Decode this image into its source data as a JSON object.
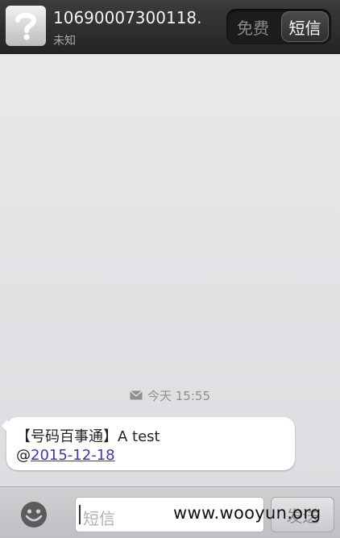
{
  "header": {
    "avatar_icon": "unknown-contact-icon",
    "contact_number": "10690007300118.",
    "contact_status": "未知",
    "mode_free_label": "免费",
    "mode_sms_label": "短信"
  },
  "thread": {
    "timestamp_icon": "envelope-icon",
    "timestamp": "今天 15:55",
    "messages": [
      {
        "line1": "【号码百事通】A test",
        "prefix": "@",
        "link": "2015-12-18"
      }
    ]
  },
  "composer": {
    "emoji_icon": "smiley-icon",
    "placeholder": "短信",
    "send_label": "发送"
  },
  "watermark": "www.wooyun.org"
}
